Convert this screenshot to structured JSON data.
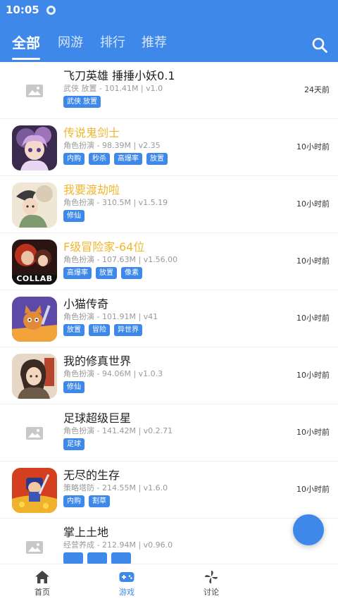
{
  "status_bar": {
    "time": "10:05"
  },
  "tabs": [
    {
      "label": "全部",
      "active": true
    },
    {
      "label": "网游",
      "active": false
    },
    {
      "label": "排行",
      "active": false
    },
    {
      "label": "推荐",
      "active": false
    }
  ],
  "search": {
    "icon": "search-icon"
  },
  "games": [
    {
      "name": "飞刀英雄 捶捶小妖0.1",
      "name_color": "#222222",
      "meta": "武侠 放置 - 101.41M | v1.0",
      "tags": [
        "武侠 放置"
      ],
      "time": "24天前",
      "icon": "image-placeholder-icon"
    },
    {
      "name": "传说鬼剑士",
      "name_color": "#f0b62e",
      "meta": "角色扮演 - 98.39M | v2.35",
      "tags": [
        "内购",
        "秒杀",
        "高爆率",
        "放置"
      ],
      "time": "10小时前",
      "icon": "game-icon"
    },
    {
      "name": "我要渡劫啦",
      "name_color": "#f0b62e",
      "meta": "角色扮演 - 310.5M | v1.5.19",
      "tags": [
        "修仙"
      ],
      "time": "10小时前",
      "icon": "game-icon"
    },
    {
      "name": "F级冒险家-64位",
      "name_color": "#f0b62e",
      "meta": "角色扮演 - 107.63M | v1.56.00",
      "tags": [
        "高爆率",
        "放置",
        "像素"
      ],
      "time": "10小时前",
      "icon": "game-icon",
      "badge": "COLLAB"
    },
    {
      "name": "小猫传奇",
      "name_color": "#222222",
      "meta": "角色扮演 - 101.91M | v41",
      "tags": [
        "放置",
        "冒险",
        "异世界"
      ],
      "time": "10小时前",
      "icon": "game-icon"
    },
    {
      "name": "我的修真世界",
      "name_color": "#222222",
      "meta": "角色扮演 - 94.06M | v1.0.3",
      "tags": [
        "修仙"
      ],
      "time": "10小时前",
      "icon": "game-icon"
    },
    {
      "name": "足球超级巨星",
      "name_color": "#222222",
      "meta": "角色扮演 - 141.42M | v0.2.71",
      "tags": [
        "足球"
      ],
      "time": "10小时前",
      "icon": "image-placeholder-icon"
    },
    {
      "name": "无尽的生存",
      "name_color": "#222222",
      "meta": "策略塔防 - 214.55M | v1.6.0",
      "tags": [
        "内购",
        "割草"
      ],
      "time": "10小时前",
      "icon": "game-icon"
    },
    {
      "name": "掌上土地",
      "name_color": "#222222",
      "meta": "经营养成 - 212.94M | v0.96.0",
      "tags": [
        "",
        "",
        ""
      ],
      "time": "",
      "icon": "image-placeholder-icon"
    }
  ],
  "bottom_nav": [
    {
      "label": "首页",
      "icon": "home-icon",
      "active": false
    },
    {
      "label": "游戏",
      "icon": "gamepad-icon",
      "active": true
    },
    {
      "label": "讨论",
      "icon": "pinwheel-icon",
      "active": false
    }
  ],
  "colors": {
    "primary": "#3e88e9",
    "highlight_name": "#f0b62e",
    "text": "#222222",
    "meta": "#999999"
  }
}
